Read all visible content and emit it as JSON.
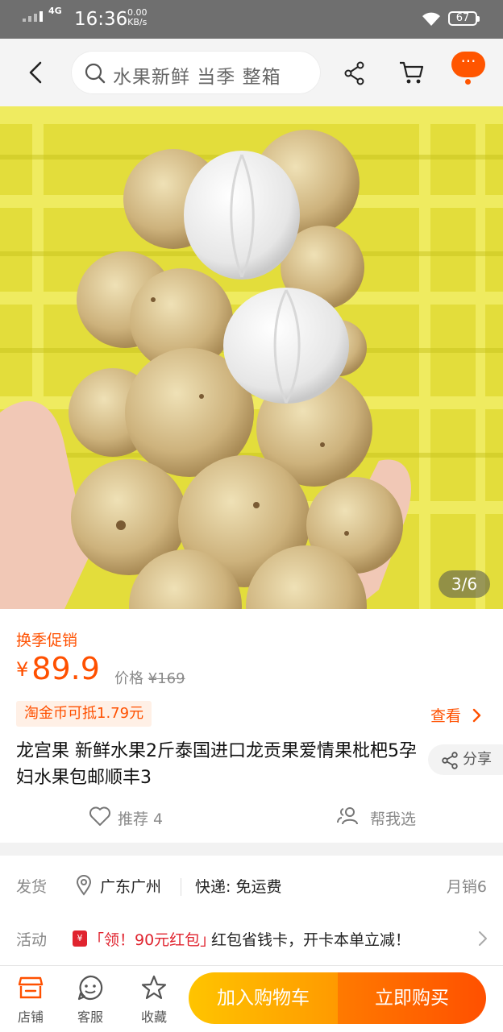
{
  "status_bar": {
    "network": "4G",
    "time": "16:36",
    "speed_value": "0.00",
    "speed_unit": "KB/s",
    "battery": "67"
  },
  "top_nav": {
    "search_placeholder": "水果新鲜 当季 整箱",
    "more_label": "···"
  },
  "gallery": {
    "current": 3,
    "total": 6,
    "indicator": "3/6"
  },
  "product": {
    "promo_label": "换季促销",
    "currency": "¥",
    "price": "89.9",
    "original_label": "价格",
    "original_price": "¥169",
    "coin_offer": "淘金币可抵1.79元",
    "check_label": "查看",
    "title": "龙宫果 新鲜水果2斤泰国进口龙贡果爱情果枇杷5孕妇水果包邮顺丰3",
    "share_label": "分享",
    "recommend_label": "推荐 4",
    "help_choose_label": "帮我选"
  },
  "shipping": {
    "label": "发货",
    "location": "广东广州",
    "express": "快递: 免运费",
    "monthly_sales": "月销6"
  },
  "activity": {
    "label": "活动",
    "tag": "「领！90元红包」",
    "description": "红包省钱卡，开卡本单立减！"
  },
  "bottom_bar": {
    "store_label": "店铺",
    "service_label": "客服",
    "favorite_label": "收藏",
    "add_cart_label": "加入购物车",
    "buy_now_label": "立即购买"
  },
  "colors": {
    "accent": "#ff5000",
    "cart_button": "#ffb400",
    "buy_button": "#ff5000",
    "status_bar": "#6f6f6f"
  }
}
